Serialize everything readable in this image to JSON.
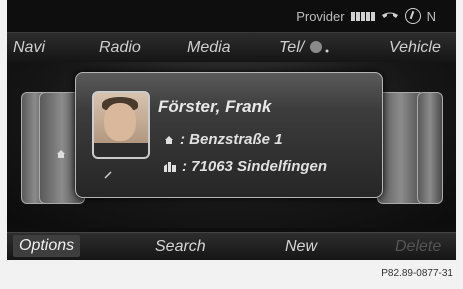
{
  "status": {
    "provider_label": "Provider",
    "extra_letter": "N"
  },
  "menu": {
    "items": [
      "Navi",
      "Radio",
      "Media",
      "Tel/",
      "Vehicle"
    ]
  },
  "contact": {
    "name": "Förster, Frank",
    "street": ": Benzstraße 1",
    "city": ": 71063 Sindelfingen"
  },
  "softkeys": {
    "options": "Options",
    "search": "Search",
    "new": "New",
    "delete": "Delete"
  },
  "caption": "P82.89-0877-31",
  "icons": {
    "signal": "signal-bars-icon",
    "phone": "phone-icon",
    "compass": "compass-icon",
    "house": "house-icon",
    "city": "city-icon"
  }
}
